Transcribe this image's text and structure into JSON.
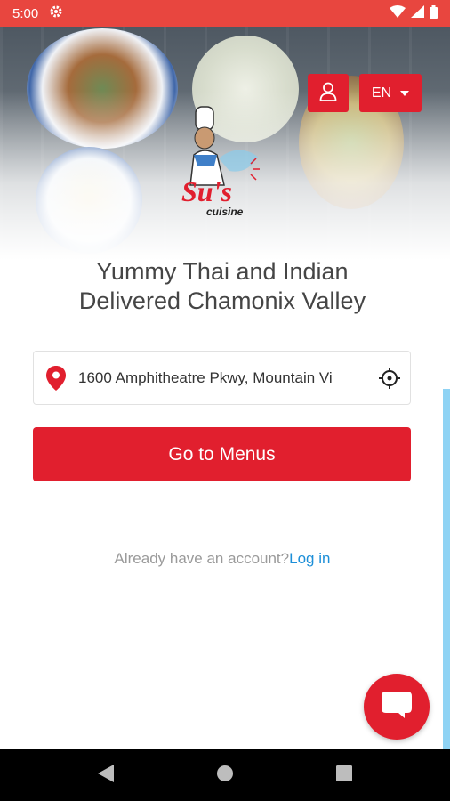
{
  "status_bar": {
    "time": "5:00",
    "icons": [
      "settings-icon",
      "wifi-icon",
      "signal-icon",
      "battery-icon"
    ]
  },
  "header": {
    "language": "EN",
    "account_icon": "user-icon"
  },
  "brand": {
    "logo_text": "Su's",
    "logo_subtext": "cuisine"
  },
  "headline": {
    "line1": "Yummy Thai and Indian",
    "line2": "Delivered Chamonix Valley"
  },
  "address": {
    "value": "1600 Amphitheatre Pkwy, Mountain Vi",
    "pin_icon": "map-pin-icon",
    "locate_icon": "crosshair-icon"
  },
  "cta": {
    "label": "Go to Menus"
  },
  "account": {
    "prompt": "Already have an account?",
    "login_label": "Log in"
  },
  "chat": {
    "icon": "chat-icon"
  },
  "colors": {
    "accent": "#e11f2e",
    "status_bar": "#e8463f",
    "link": "#1d8fd8",
    "scroll": "#8fd3f4"
  }
}
